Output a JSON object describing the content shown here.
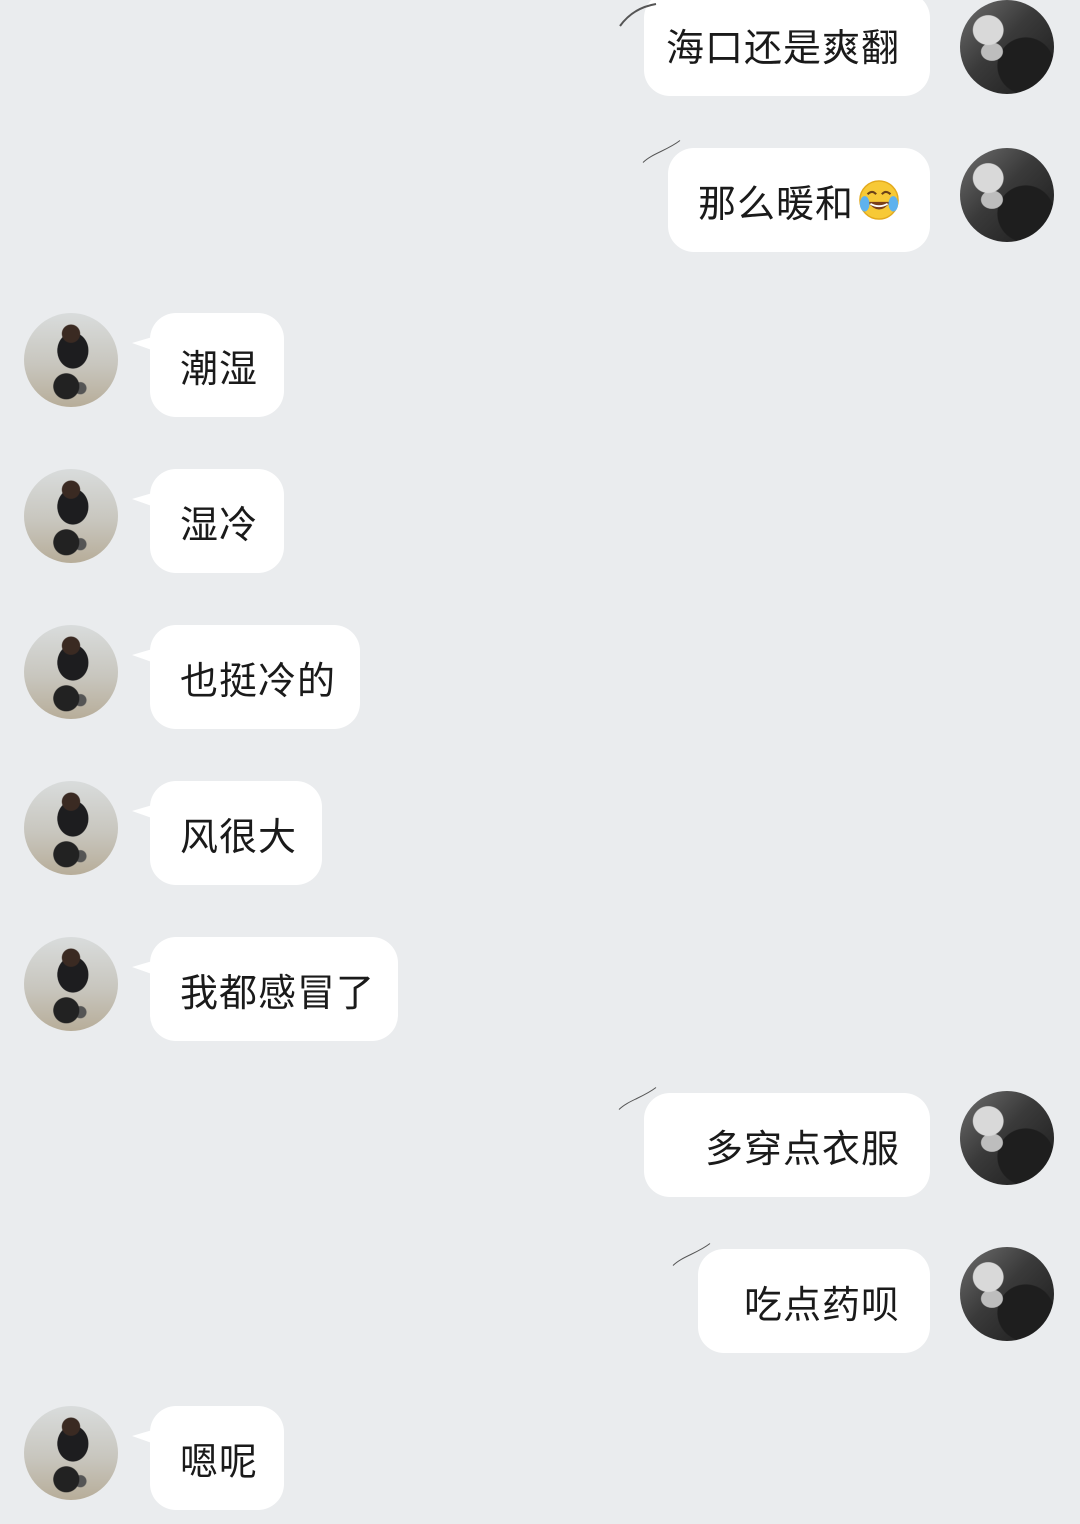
{
  "messages": [
    {
      "side": "right",
      "text": "海口还是爽翻"
    },
    {
      "side": "right",
      "text": "那么暖和",
      "emoji": "tears-of-joy-emoji"
    },
    {
      "side": "left",
      "text": "潮湿"
    },
    {
      "side": "left",
      "text": "湿冷"
    },
    {
      "side": "left",
      "text": "也挺冷的"
    },
    {
      "side": "left",
      "text": "风很大"
    },
    {
      "side": "left",
      "text": "我都感冒了"
    },
    {
      "side": "right",
      "text": "多穿点衣服"
    },
    {
      "side": "right",
      "text": "吃点药呗"
    },
    {
      "side": "left",
      "text": "嗯呢"
    }
  ]
}
